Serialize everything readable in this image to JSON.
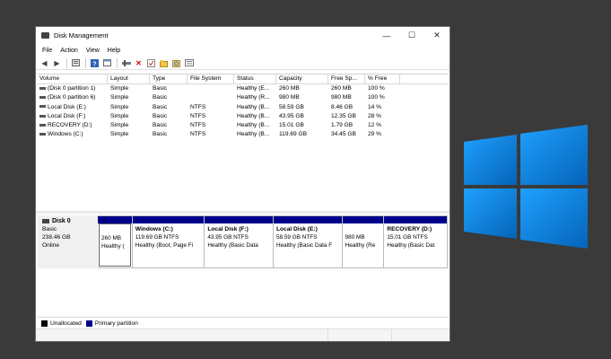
{
  "window": {
    "title": "Disk Management",
    "minimize": "—",
    "maximize": "☐",
    "close": "✕"
  },
  "menu": [
    "File",
    "Action",
    "View",
    "Help"
  ],
  "toolbar_icons": [
    "back-arrow-icon",
    "forward-arrow-icon",
    "properties-icon",
    "help-icon",
    "console-icon",
    "connect-icon",
    "delete-icon",
    "check-icon",
    "folder-icon",
    "refresh-icon",
    "list-icon"
  ],
  "volumes": {
    "columns": [
      "Volume",
      "Layout",
      "Type",
      "File System",
      "Status",
      "Capacity",
      "Free Sp...",
      "% Free"
    ],
    "rows": [
      [
        "(Disk 0 partition 1)",
        "Simple",
        "Basic",
        "",
        "Healthy (E...",
        "260 MB",
        "260 MB",
        "100 %"
      ],
      [
        "(Disk 0 partition 6)",
        "Simple",
        "Basic",
        "",
        "Healthy (R...",
        "980 MB",
        "980 MB",
        "100 %"
      ],
      [
        "Local Disk (E:)",
        "Simple",
        "Basic",
        "NTFS",
        "Healthy (B...",
        "58.59 GB",
        "8.46 GB",
        "14 %"
      ],
      [
        "Local Disk (F:)",
        "Simple",
        "Basic",
        "NTFS",
        "Healthy (B...",
        "43.95 GB",
        "12.35 GB",
        "28 %"
      ],
      [
        "RECOVERY (D:)",
        "Simple",
        "Basic",
        "NTFS",
        "Healthy (B...",
        "15.01 GB",
        "1.79 GB",
        "12 %"
      ],
      [
        "Windows (C:)",
        "Simple",
        "Basic",
        "NTFS",
        "Healthy (B...",
        "119.69 GB",
        "34.45 GB",
        "29 %"
      ]
    ]
  },
  "disk": {
    "name": "Disk 0",
    "type": "Basic",
    "size": "238.46 GB",
    "status": "Online",
    "partitions": [
      {
        "label": "",
        "size": "260 MB",
        "status": "Healthy ("
      },
      {
        "label": "Windows  (C:)",
        "size": "119.69 GB NTFS",
        "status": "Healthy (Boot, Page Fi"
      },
      {
        "label": "Local Disk  (F:)",
        "size": "43.95 GB NTFS",
        "status": "Healthy (Basic Data"
      },
      {
        "label": "Local Disk  (E:)",
        "size": "58.59 GB NTFS",
        "status": "Healthy (Basic Data F"
      },
      {
        "label": "",
        "size": "980 MB",
        "status": "Healthy (Re"
      },
      {
        "label": "RECOVERY  (D:)",
        "size": "15.01 GB NTFS",
        "status": "Healthy (Basic Dat"
      }
    ]
  },
  "legend": [
    {
      "label": "Unallocated",
      "color": "#000000"
    },
    {
      "label": "Primary partition",
      "color": "#00008b"
    }
  ],
  "colors": {
    "partition_stripe": "#00008b",
    "background": "#3a3a3a",
    "logo_blue": "#0a78d7"
  }
}
